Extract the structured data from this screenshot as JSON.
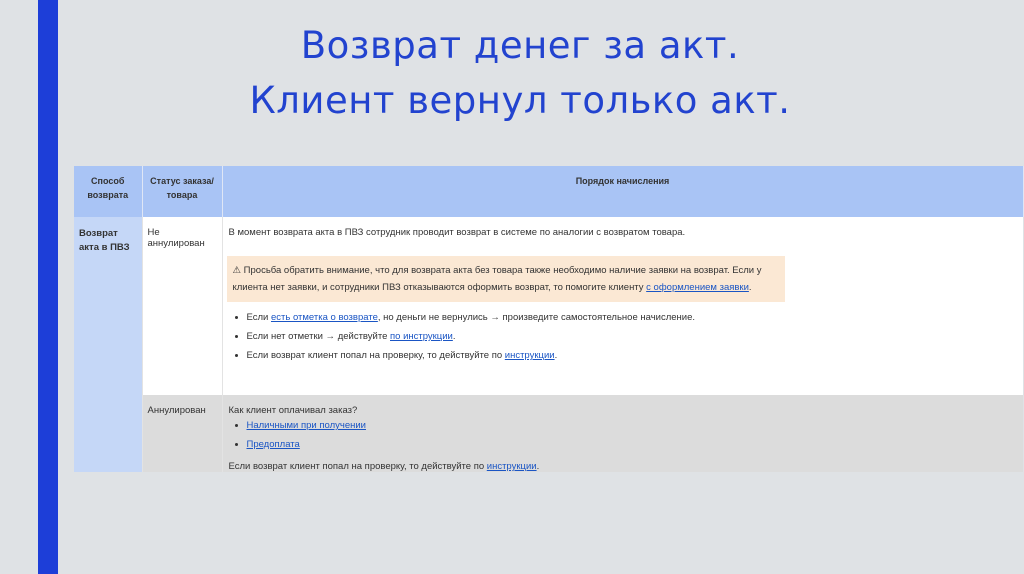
{
  "title": {
    "line1": "Возврат денег за акт.",
    "line2": "Клиент вернул только акт."
  },
  "table": {
    "headers": {
      "col1": "Способ возврата",
      "col2": "Статус заказа/ товара",
      "col3": "Порядок начисления"
    },
    "row1": {
      "method": "Возврат акта в ПВЗ",
      "status": "Не аннулирован",
      "intro": "В момент возврата акта в ПВЗ сотрудник проводит возврат в системе по аналогии с возвратом товара.",
      "notice_icon": "⚠",
      "notice_text": "Просьба обратить внимание, что для возврата акта без товара также необходимо наличие заявки на возврат. Если у клиента нет заявки, и сотрудники ПВЗ отказываются оформить возврат, то помогите клиенту",
      "notice_link": "с оформлением заявки",
      "notice_end": ".",
      "b1_pre": "Если ",
      "b1_link": "есть отметка о возврате",
      "b1_post": ", но деньги не вернулись → произведите самостоятельное начисление.",
      "b2_pre": "Если нет отметки → действуйте ",
      "b2_link": "по инструкции",
      "b2_post": ".",
      "b3_pre": "Если возврат клиент попал на проверку, то действуйте по ",
      "b3_link": "инструкции",
      "b3_post": "."
    },
    "row2": {
      "status": "Аннулирован",
      "question": "Как клиент оплачивал заказ?",
      "opt1": "Наличными при получении",
      "opt2": "Предоплата",
      "last_pre": "Если возврат клиент попал на проверку, то действуйте по ",
      "last_link": "инструкции",
      "last_post": "."
    }
  }
}
